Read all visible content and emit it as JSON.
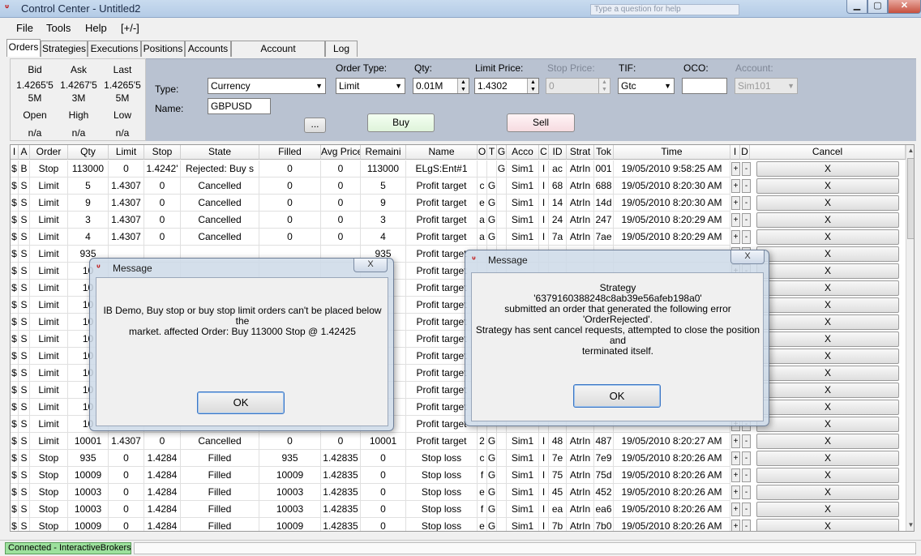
{
  "window": {
    "title": "Control Center - Untitled2",
    "search_placeholder": "Type a question for help"
  },
  "menu": [
    "File",
    "Tools",
    "Help",
    "[+/-]"
  ],
  "tabs": [
    "Orders",
    "Strategies",
    "Executions",
    "Positions",
    "Accounts",
    "Account Performance",
    "Log"
  ],
  "active_tab": "Orders",
  "quote": {
    "headers": [
      "Bid",
      "Ask",
      "Last"
    ],
    "prices": [
      "1.4265'5",
      "1.4267'5",
      "1.4265'5"
    ],
    "sizes": [
      "5M",
      "3M",
      "5M"
    ],
    "headers2": [
      "Open",
      "High",
      "Low"
    ],
    "values2": [
      "n/a",
      "n/a",
      "n/a"
    ]
  },
  "order_entry": {
    "type_label": "Type:",
    "type_value": "Currency",
    "name_label": "Name:",
    "name_value": "GBPUSD",
    "order_type_label": "Order Type:",
    "order_type_value": "Limit",
    "qty_label": "Qty:",
    "qty_value": "0.01M",
    "limit_price_label": "Limit Price:",
    "limit_price_value": "1.4302",
    "stop_price_label": "Stop Price:",
    "stop_price_value": "0",
    "tif_label": "TIF:",
    "tif_value": "Gtc",
    "oco_label": "OCO:",
    "oco_value": "",
    "account_label": "Account:",
    "account_value": "Sim101",
    "ellipsis_label": "...",
    "buy_label": "Buy",
    "sell_label": "Sell"
  },
  "grid": {
    "headers": [
      "I",
      "A",
      "Order",
      "Qty",
      "Limit",
      "Stop",
      "State",
      "Filled",
      "Avg Price",
      "Remaini",
      "Name",
      "O",
      "T",
      "G",
      "Acco",
      "C",
      "ID",
      "Strat",
      "Tok",
      "Time",
      "I",
      "D",
      "Cancel"
    ],
    "plus_label": "+",
    "minus_label": "-",
    "cancel_label": "X",
    "rows": [
      [
        "$",
        "B",
        "Stop",
        "113000",
        "0",
        "1.4242'",
        "Rejected: Buy s",
        "0",
        "0",
        "113000",
        "ELgS:Ent#1",
        "",
        "",
        "G",
        "Sim1",
        "I",
        "ac",
        "AtrIn",
        "001",
        "19/05/2010 9:58:25 AM"
      ],
      [
        "$",
        "S",
        "Limit",
        "5",
        "1.4307",
        "0",
        "Cancelled",
        "0",
        "0",
        "5",
        "Profit target",
        "c",
        "G",
        "",
        "Sim1",
        "I",
        "68",
        "AtrIn",
        "688",
        "19/05/2010 8:20:30 AM"
      ],
      [
        "$",
        "S",
        "Limit",
        "9",
        "1.4307",
        "0",
        "Cancelled",
        "0",
        "0",
        "9",
        "Profit target",
        "e",
        "G",
        "",
        "Sim1",
        "I",
        "14",
        "AtrIn",
        "14d",
        "19/05/2010 8:20:30 AM"
      ],
      [
        "$",
        "S",
        "Limit",
        "3",
        "1.4307",
        "0",
        "Cancelled",
        "0",
        "0",
        "3",
        "Profit target",
        "a",
        "G",
        "",
        "Sim1",
        "I",
        "24",
        "AtrIn",
        "247",
        "19/05/2010 8:20:29 AM"
      ],
      [
        "$",
        "S",
        "Limit",
        "4",
        "1.4307",
        "0",
        "Cancelled",
        "0",
        "0",
        "4",
        "Profit target",
        "a",
        "G",
        "",
        "Sim1",
        "I",
        "7a",
        "AtrIn",
        "7ae",
        "19/05/2010 8:20:29 AM"
      ],
      [
        "$",
        "S",
        "Limit",
        "935",
        "",
        "",
        "",
        "",
        "",
        "935",
        "Profit target",
        "",
        "",
        "",
        "",
        "",
        "",
        "",
        "",
        ""
      ],
      [
        "$",
        "S",
        "Limit",
        "10",
        "",
        "",
        "",
        "",
        "",
        "",
        "Profit target",
        "",
        "",
        "",
        "",
        "",
        "",
        "",
        "",
        ""
      ],
      [
        "$",
        "S",
        "Limit",
        "10",
        "",
        "",
        "",
        "",
        "",
        "",
        "Profit target",
        "",
        "",
        "",
        "",
        "",
        "",
        "",
        "",
        ""
      ],
      [
        "$",
        "S",
        "Limit",
        "10",
        "",
        "",
        "",
        "",
        "",
        "",
        "Profit target",
        "",
        "",
        "",
        "",
        "",
        "",
        "",
        "",
        ""
      ],
      [
        "$",
        "S",
        "Limit",
        "10",
        "",
        "",
        "",
        "",
        "",
        "",
        "Profit target",
        "",
        "",
        "",
        "",
        "",
        "",
        "",
        "",
        ""
      ],
      [
        "$",
        "S",
        "Limit",
        "10",
        "",
        "",
        "",
        "",
        "",
        "",
        "Profit target",
        "",
        "",
        "",
        "",
        "",
        "",
        "",
        "",
        ""
      ],
      [
        "$",
        "S",
        "Limit",
        "10",
        "",
        "",
        "",
        "",
        "",
        "",
        "Profit target",
        "",
        "",
        "",
        "",
        "",
        "",
        "",
        "",
        ""
      ],
      [
        "$",
        "S",
        "Limit",
        "10",
        "",
        "",
        "",
        "",
        "",
        "",
        "Profit target",
        "",
        "",
        "",
        "",
        "",
        "",
        "",
        "",
        ""
      ],
      [
        "$",
        "S",
        "Limit",
        "10",
        "",
        "",
        "",
        "",
        "",
        "",
        "Profit target",
        "",
        "",
        "",
        "",
        "",
        "",
        "",
        "",
        ""
      ],
      [
        "$",
        "S",
        "Limit",
        "10",
        "",
        "",
        "",
        "",
        "",
        "",
        "Profit target",
        "",
        "",
        "",
        "",
        "",
        "",
        "",
        "",
        ""
      ],
      [
        "$",
        "S",
        "Limit",
        "10",
        "",
        "",
        "",
        "",
        "",
        "",
        "Profit target",
        "",
        "",
        "",
        "",
        "",
        "",
        "",
        "",
        ""
      ],
      [
        "$",
        "S",
        "Limit",
        "10001",
        "1.4307",
        "0",
        "Cancelled",
        "0",
        "0",
        "10001",
        "Profit target",
        "2",
        "G",
        "",
        "Sim1",
        "I",
        "48",
        "AtrIn",
        "487",
        "19/05/2010 8:20:27 AM"
      ],
      [
        "$",
        "S",
        "Stop",
        "935",
        "0",
        "1.4284",
        "Filled",
        "935",
        "1.42835",
        "0",
        "Stop loss",
        "c",
        "G",
        "",
        "Sim1",
        "I",
        "7e",
        "AtrIn",
        "7e9",
        "19/05/2010 8:20:26 AM"
      ],
      [
        "$",
        "S",
        "Stop",
        "10009",
        "0",
        "1.4284",
        "Filled",
        "10009",
        "1.42835",
        "0",
        "Stop loss",
        "f",
        "G",
        "",
        "Sim1",
        "I",
        "75",
        "AtrIn",
        "75d",
        "19/05/2010 8:20:26 AM"
      ],
      [
        "$",
        "S",
        "Stop",
        "10003",
        "0",
        "1.4284",
        "Filled",
        "10003",
        "1.42835",
        "0",
        "Stop loss",
        "e",
        "G",
        "",
        "Sim1",
        "I",
        "45",
        "AtrIn",
        "452",
        "19/05/2010 8:20:26 AM"
      ],
      [
        "$",
        "S",
        "Stop",
        "10003",
        "0",
        "1.4284",
        "Filled",
        "10003",
        "1.42835",
        "0",
        "Stop loss",
        "f",
        "G",
        "",
        "Sim1",
        "I",
        "ea",
        "AtrIn",
        "ea6",
        "19/05/2010 8:20:26 AM"
      ],
      [
        "$",
        "S",
        "Stop",
        "10009",
        "0",
        "1.4284",
        "Filled",
        "10009",
        "1.42835",
        "0",
        "Stop loss",
        "e",
        "G",
        "",
        "Sim1",
        "I",
        "7b",
        "AtrIn",
        "7b0",
        "19/05/2010 8:20:26 AM"
      ]
    ]
  },
  "status": {
    "connection": "Connected - InteractiveBrokers",
    "color": "#9de19d"
  },
  "dialog1": {
    "title": "Message",
    "close_label": "X",
    "message_line1": "IB Demo, Buy stop or buy stop limit orders can't be placed below the",
    "message_line2": "market. affected Order: Buy 113000 Stop @ 1.42425",
    "ok_label": "OK"
  },
  "dialog2": {
    "title": "Message",
    "close_label": "X",
    "line1": "Strategy",
    "line2": "'6379160388248c8ab39e56afeb198a0'",
    "line3": "submitted an order that generated the following error 'OrderRejected'.",
    "line4": "Strategy has sent cancel requests, attempted to close the position and",
    "line5": "terminated itself.",
    "ok_label": "OK"
  }
}
